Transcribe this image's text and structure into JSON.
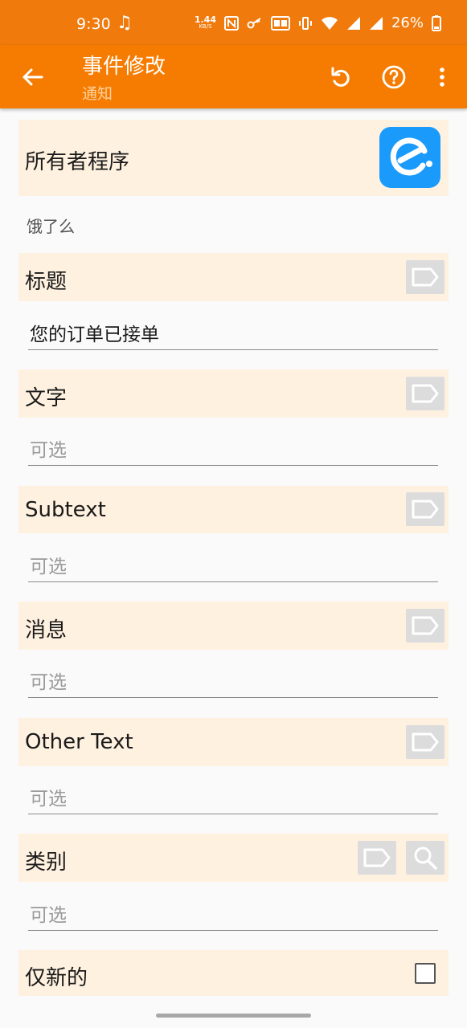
{
  "status_bar": {
    "time": "9:30",
    "net_speed_value": "1.44",
    "net_speed_unit": "KB/S",
    "battery_percent": "26%"
  },
  "app_bar": {
    "title": "事件修改",
    "subtitle": "通知"
  },
  "owner": {
    "label": "所有者程序",
    "app_name": "饿了么"
  },
  "fields": [
    {
      "label": "标题",
      "value": "您的订单已接单",
      "placeholder": ""
    },
    {
      "label": "文字",
      "value": "",
      "placeholder": "可选"
    },
    {
      "label": "Subtext",
      "value": "",
      "placeholder": "可选"
    },
    {
      "label": "消息",
      "value": "",
      "placeholder": "可选"
    },
    {
      "label": "Other Text",
      "value": "",
      "placeholder": "可选"
    },
    {
      "label": "类别",
      "value": "",
      "placeholder": "可选"
    }
  ],
  "new_only": {
    "label": "仅新的",
    "checked": false
  },
  "colors": {
    "status_bar": "#f07a0c",
    "app_bar": "#f57c00",
    "section_bg": "#fff1e0",
    "app_icon": "#1a9bfc"
  }
}
